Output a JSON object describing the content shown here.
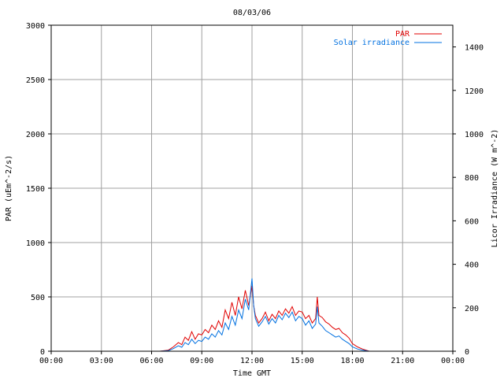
{
  "chart_data": {
    "type": "line",
    "title": "08/03/06",
    "xlabel": "Time GMT",
    "ylabel": "PAR (uEm^-2/s)",
    "y2label": "Licor Irradiance (W m^-2)",
    "x_ticks": [
      "00:00",
      "03:00",
      "06:00",
      "09:00",
      "12:00",
      "15:00",
      "18:00",
      "21:00",
      "00:00"
    ],
    "x_range_hours": [
      0,
      24
    ],
    "ylim": [
      0,
      3000
    ],
    "y_ticks": [
      0,
      500,
      1000,
      1500,
      2000,
      2500,
      3000
    ],
    "y2lim": [
      0,
      1500
    ],
    "y2_ticks": [
      0,
      200,
      400,
      600,
      800,
      1000,
      1200,
      1400
    ],
    "grid": true,
    "legend_position": "top-right",
    "series": [
      {
        "name": "PAR",
        "axis": "left",
        "color": "#e00000",
        "x": [
          0,
          6.5,
          7,
          7.3,
          7.6,
          7.8,
          8.0,
          8.2,
          8.4,
          8.6,
          8.8,
          9.0,
          9.2,
          9.4,
          9.6,
          9.8,
          10.0,
          10.2,
          10.4,
          10.6,
          10.8,
          11.0,
          11.2,
          11.4,
          11.6,
          11.8,
          12.0,
          12.1,
          12.2,
          12.4,
          12.6,
          12.8,
          13.0,
          13.2,
          13.4,
          13.6,
          13.8,
          14.0,
          14.2,
          14.4,
          14.6,
          14.8,
          15.0,
          15.2,
          15.4,
          15.6,
          15.8,
          15.9,
          16.0,
          16.2,
          16.4,
          16.6,
          16.8,
          17.0,
          17.2,
          17.4,
          17.6,
          17.8,
          18.0,
          18.3,
          18.6,
          19,
          24
        ],
        "y": [
          0,
          0,
          10,
          40,
          80,
          60,
          130,
          100,
          180,
          110,
          160,
          150,
          200,
          170,
          240,
          200,
          280,
          220,
          380,
          300,
          450,
          330,
          500,
          390,
          560,
          420,
          600,
          420,
          330,
          260,
          300,
          360,
          280,
          340,
          300,
          370,
          330,
          390,
          350,
          410,
          330,
          370,
          360,
          300,
          330,
          260,
          300,
          500,
          330,
          310,
          270,
          250,
          220,
          200,
          210,
          170,
          150,
          120,
          70,
          40,
          20,
          0,
          0
        ]
      },
      {
        "name": "Solar irradiance",
        "axis": "right",
        "color": "#0070e0",
        "x": [
          0,
          6.5,
          7,
          7.3,
          7.6,
          7.8,
          8.0,
          8.2,
          8.4,
          8.6,
          8.8,
          9.0,
          9.2,
          9.4,
          9.6,
          9.8,
          10.0,
          10.2,
          10.4,
          10.6,
          10.8,
          11.0,
          11.2,
          11.4,
          11.6,
          11.8,
          12.0,
          12.1,
          12.2,
          12.4,
          12.6,
          12.8,
          13.0,
          13.2,
          13.4,
          13.6,
          13.8,
          14.0,
          14.2,
          14.4,
          14.6,
          14.8,
          15.0,
          15.2,
          15.4,
          15.6,
          15.8,
          15.9,
          16.0,
          16.2,
          16.4,
          16.6,
          16.8,
          17.0,
          17.2,
          17.4,
          17.6,
          17.8,
          18.0,
          18.3,
          18.6,
          19,
          24
        ],
        "y": [
          0,
          0,
          3,
          12,
          25,
          18,
          40,
          30,
          55,
          35,
          50,
          45,
          65,
          55,
          80,
          65,
          95,
          75,
          130,
          100,
          160,
          120,
          190,
          150,
          240,
          190,
          335,
          210,
          150,
          115,
          135,
          160,
          125,
          150,
          130,
          165,
          145,
          175,
          155,
          180,
          140,
          160,
          150,
          120,
          140,
          105,
          125,
          205,
          130,
          115,
          95,
          85,
          75,
          65,
          70,
          55,
          45,
          35,
          20,
          10,
          5,
          0,
          0
        ]
      }
    ]
  }
}
